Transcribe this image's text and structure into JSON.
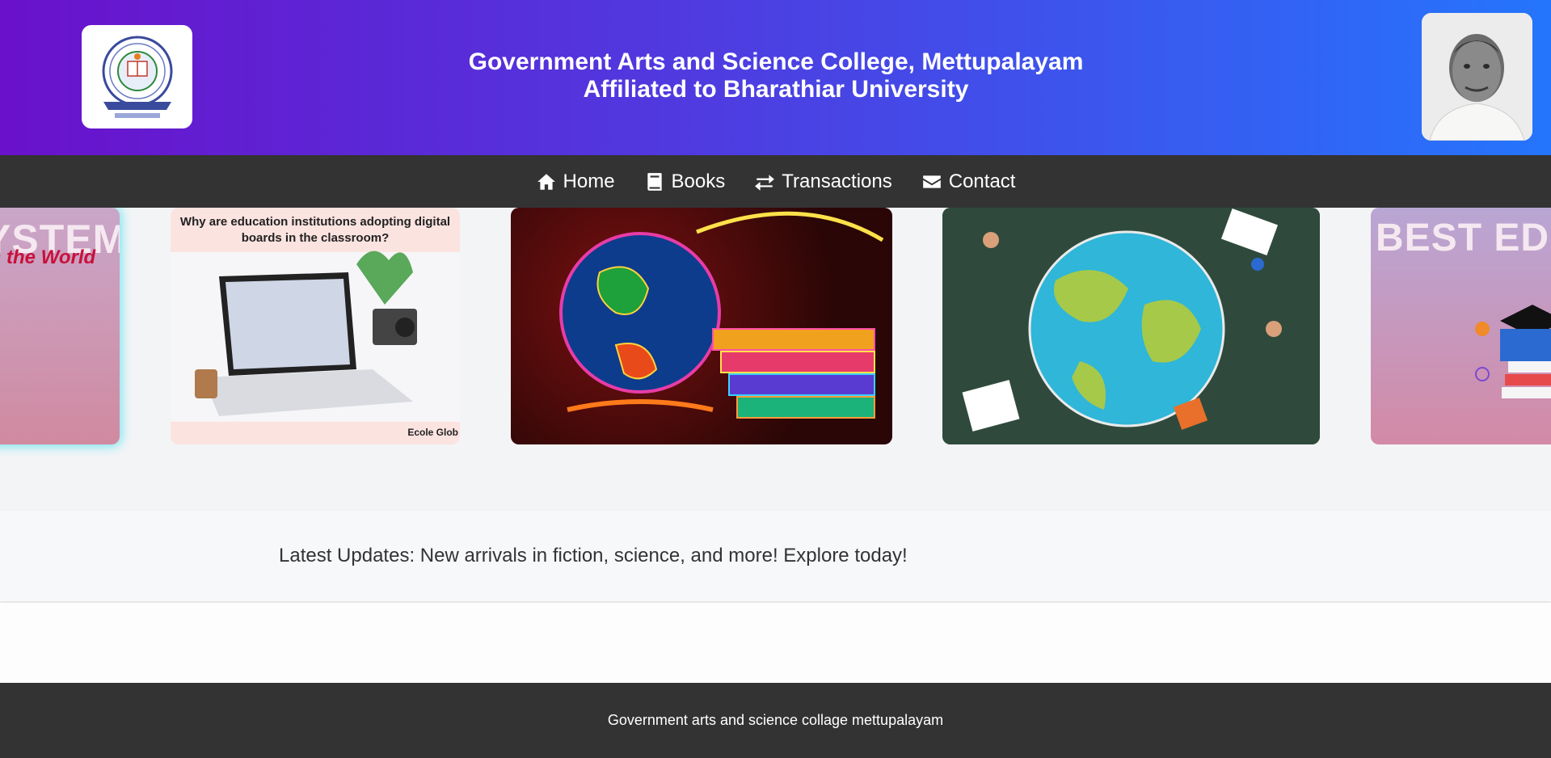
{
  "header": {
    "college_name": "Government Arts and Science College, Mettupalayam",
    "affiliation": "Affiliated to Bharathiar University",
    "logo_icon": "college-emblem-icon",
    "portrait_icon": "portrait-photo"
  },
  "nav": {
    "items": [
      {
        "label": "Home",
        "icon": "home-icon"
      },
      {
        "label": "Books",
        "icon": "book-icon"
      },
      {
        "label": "Transactions",
        "icon": "exchange-icon"
      },
      {
        "label": "Contact",
        "icon": "envelope-icon"
      }
    ]
  },
  "carousel": {
    "slides": [
      {
        "text_main": "YSTEM",
        "text_sub": "in the World"
      },
      {
        "caption": "Why are education institutions adopting digital boards in the classroom?",
        "brand": "Ecole Glob"
      },
      {
        "caption": ""
      },
      {
        "caption": ""
      },
      {
        "text_main": "BEST EDUCA"
      }
    ]
  },
  "updates": {
    "text": "Latest Updates: New arrivals in fiction, science, and more! Explore today!"
  },
  "footer": {
    "text": "Government arts and science collage mettupalayam"
  },
  "colors": {
    "header_gradient_start": "#6a11cb",
    "header_gradient_end": "#2575fc",
    "nav_bg": "#333333",
    "footer_bg": "#333333"
  }
}
